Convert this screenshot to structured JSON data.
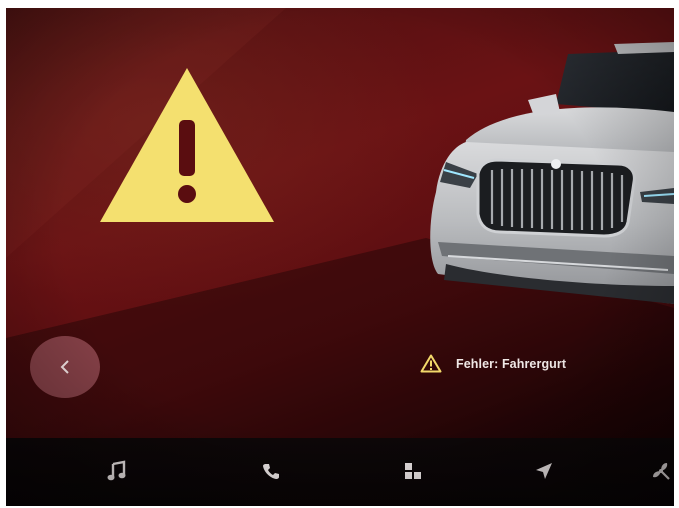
{
  "status": {
    "icon": "warning-icon",
    "text": "Fehler: Fahrergurt",
    "icon_color": "#f2d86a"
  },
  "alert": {
    "icon": "warning-triangle-icon",
    "color": "#f4e06f"
  },
  "back_button": {
    "icon": "chevron-left-icon"
  },
  "nav": {
    "items": [
      {
        "icon": "music-icon"
      },
      {
        "icon": "phone-icon"
      },
      {
        "icon": "apps-grid-icon"
      },
      {
        "icon": "navigation-icon"
      },
      {
        "icon": "climate-fan-icon"
      }
    ]
  },
  "theme": {
    "background": "#5a0d10",
    "accent": "#f4e06f"
  }
}
